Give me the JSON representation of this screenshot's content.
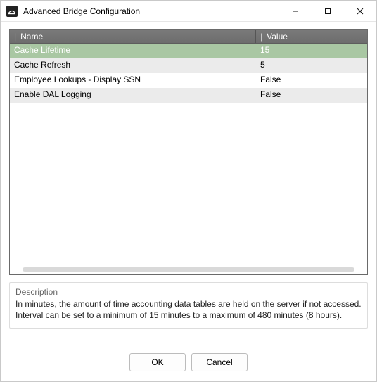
{
  "window": {
    "title": "Advanced Bridge Configuration"
  },
  "grid": {
    "columns": {
      "name": "Name",
      "value": "Value"
    },
    "rows": [
      {
        "name": "Cache Lifetime",
        "value": "15",
        "selected": true
      },
      {
        "name": "Cache Refresh",
        "value": "5",
        "selected": false
      },
      {
        "name": "Employee Lookups - Display SSN",
        "value": "False",
        "selected": false
      },
      {
        "name": "Enable DAL Logging",
        "value": "False",
        "selected": false
      }
    ]
  },
  "description": {
    "label": "Description",
    "text": "In minutes, the amount of time accounting data tables are held on the server if not accessed. Interval can be set to a minimum of 15 minutes to a maximum of 480 minutes (8 hours)."
  },
  "buttons": {
    "ok": "OK",
    "cancel": "Cancel"
  }
}
